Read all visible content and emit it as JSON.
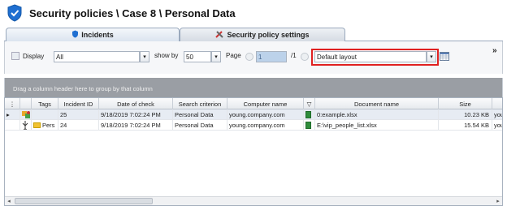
{
  "header": {
    "title": "Security policies \\ Case 8 \\ Personal Data"
  },
  "tabs": [
    {
      "label": "Incidents"
    },
    {
      "label": "Security policy settings"
    }
  ],
  "toolbar": {
    "display_label": "Display",
    "display_value": "All",
    "showby_label": "show by",
    "showby_value": "50",
    "page_label": "Page",
    "page_value": "1",
    "page_total": "/1",
    "layout_value": "Default layout",
    "more": "»"
  },
  "group_hint": "Drag a column header here to group by that column",
  "columns": [
    {
      "key": "tags",
      "label": "Tags"
    },
    {
      "key": "incident_id",
      "label": "Incident ID"
    },
    {
      "key": "date",
      "label": "Date of check"
    },
    {
      "key": "criterion",
      "label": "Search criterion"
    },
    {
      "key": "computer",
      "label": "Computer name"
    },
    {
      "key": "filter",
      "label": ""
    },
    {
      "key": "document",
      "label": "Document name"
    },
    {
      "key": "size",
      "label": "Size"
    },
    {
      "key": "more",
      "label": ""
    }
  ],
  "rows": [
    {
      "tags": "",
      "incident_id": "25",
      "date": "9/18/2019 7:02:24 PM",
      "criterion": "Personal Data",
      "computer": "young.company.com",
      "document": "0:example.xlsx",
      "size": "10.23 KB",
      "more": "youn"
    },
    {
      "tags": "Pers",
      "incident_id": "24",
      "date": "9/18/2019 7:02:24 PM",
      "criterion": "Personal Data",
      "computer": "young.company.com",
      "document": "E:\\vip_people_list.xlsx",
      "size": "15.54 KB",
      "more": "youn"
    }
  ],
  "colors": {
    "accent": "#1f6fd1",
    "highlight": "#e02020",
    "group_area": "#9a9ea4"
  }
}
